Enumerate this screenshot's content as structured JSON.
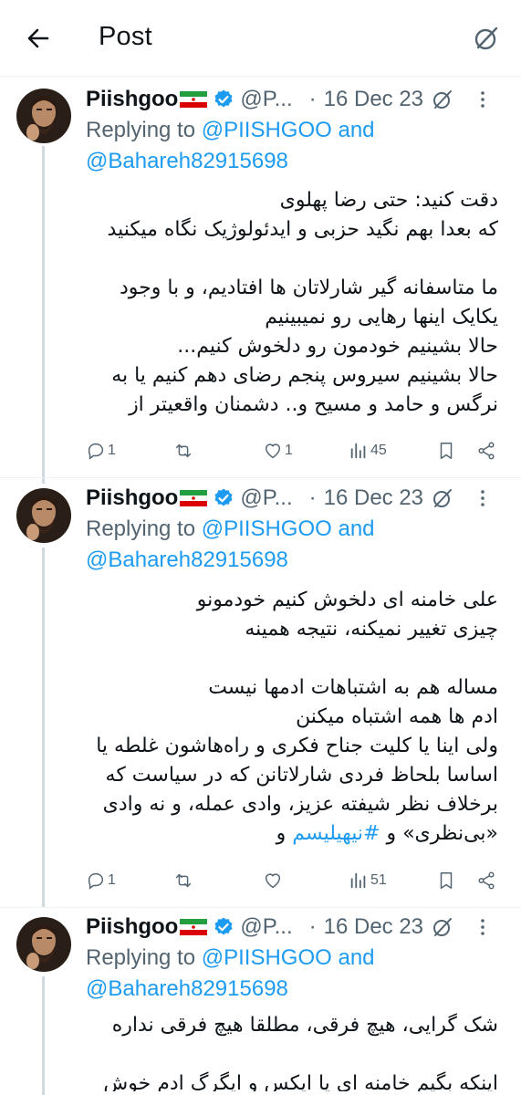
{
  "header": {
    "title": "Post"
  },
  "colors": {
    "accent": "#1d9bf0",
    "muted": "#536471",
    "text": "#0f1419",
    "thread_line": "#cfd9de"
  },
  "tweets": [
    {
      "display_name": "Piishgoo",
      "handle": "@P...",
      "date": "16 Dec 23",
      "replying_prefix": "Replying to",
      "mention1": "@PIISHGOO",
      "and": "and",
      "mention2": "@Bahareh82915698",
      "lines": [
        "دقت کنید: حتی رضا پهلوی",
        "که بعدا بهم نگید حزبی و ایدئولوژیک نگاه میکنید",
        "",
        "ما متاسفانه گیر شارلاتان ها افتادیم، و با وجود",
        "یکایک اینها رهایی رو نمیبینیم",
        "حالا بشینیم خودمون رو دلخوش کنیم...",
        "حالا بشینیم سیروس پنجم رضای دهم کنیم یا به",
        "نرگس و حامد و مسیح و.. دشمنان واقعیتر از"
      ],
      "replies": "1",
      "reposts": "",
      "likes": "1",
      "views": "45"
    },
    {
      "display_name": "Piishgoo",
      "handle": "@P...",
      "date": "16 Dec 23",
      "replying_prefix": "Replying to",
      "mention1": "@PIISHGOO",
      "and": "and",
      "mention2": "@Bahareh82915698",
      "lines": [
        "علی خامنه ای دلخوش کنیم خودمونو",
        "چیزی تغییر نمیکنه، نتیجه همینه",
        "",
        "مساله هم به اشتباهات ادمها نیست",
        "ادم ها همه اشتباه میکنن",
        "ولی اینا یا کلیت جناح فکری و راه‌هاشون غلطه یا",
        "اساسا بلحاظ فردی شارلاتانن که در سیاست که",
        "برخلاف نظر شیفته عزیز، وادی عمله، و نه وادی"
      ],
      "last_line_text": "«بی‌نظری» و ",
      "last_line_hashtag": "#نیهیلیسم",
      "last_line_tail": " و",
      "replies": "1",
      "reposts": "",
      "likes": "",
      "views": "51"
    },
    {
      "display_name": "Piishgoo",
      "handle": "@P...",
      "date": "16 Dec 23",
      "replying_prefix": "Replying to",
      "mention1": "@PIISHGOO",
      "and": "and",
      "mention2": "@Bahareh82915698",
      "lines": [
        "شک گرایی،  هیچ فرقی، مطلقا هیچ فرقی نداره",
        "",
        "اینکه بگیم خامنه ای یا ایکس و ایگرگ ادم خوش"
      ]
    }
  ]
}
